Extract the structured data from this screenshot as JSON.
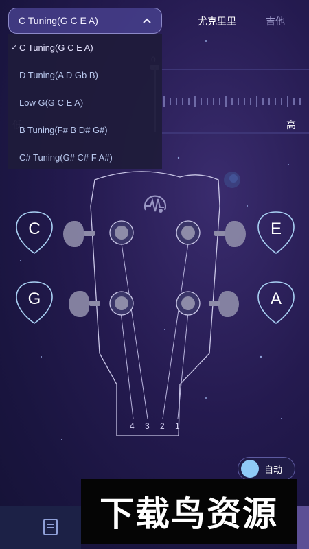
{
  "header": {
    "current_tuning": "C Tuning(G C E A)",
    "tab_ukulele": "尤克里里",
    "tab_guitar": "吉他"
  },
  "dropdown": {
    "items": [
      {
        "label": "C Tuning(G C E A)",
        "selected": true
      },
      {
        "label": "D Tuning(A D Gb B)",
        "selected": false
      },
      {
        "label": "Low G(G C E A)",
        "selected": false
      },
      {
        "label": "B Tuning(F# B D# G#)",
        "selected": false
      },
      {
        "label": "C# Tuning(G# C# F A#)",
        "selected": false
      }
    ],
    "check_mark": "✓"
  },
  "meter": {
    "zero": "0",
    "low_label": "低",
    "high_label": "高"
  },
  "strings": {
    "top_left": "C",
    "top_right": "E",
    "bottom_left": "G",
    "bottom_right": "A",
    "numbers": [
      "4",
      "3",
      "2",
      "1"
    ]
  },
  "auto_toggle": {
    "label": "自动",
    "on": true
  },
  "watermark": {
    "text": "下载鸟资源"
  },
  "colors": {
    "accent": "#8fcaf7",
    "background": "#241a4f",
    "headstock_outline": "#c9c6e6"
  },
  "icons": {
    "dropdown": "chevron-up-icon",
    "logo": "tuner-logo-icon",
    "bottom_tab": "notebook-icon"
  }
}
